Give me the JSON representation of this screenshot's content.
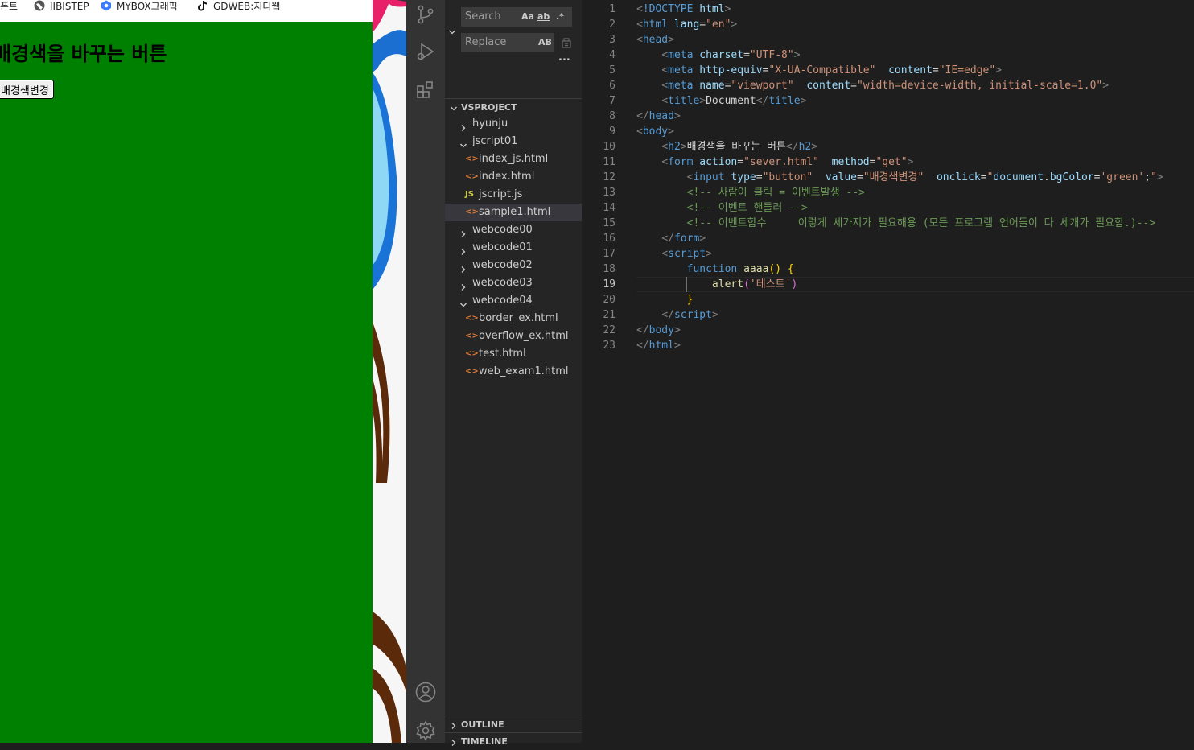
{
  "browser": {
    "bookmarks": [
      {
        "label": "폰트",
        "icon": "font-bookmark-icon"
      },
      {
        "label": "IIBISTEP",
        "icon": "globe-icon"
      },
      {
        "label": "MYBOX그래픽",
        "icon": "mybox-icon"
      },
      {
        "label": "GDWEB:지디웹",
        "icon": "tiktok-icon"
      }
    ],
    "page": {
      "heading": "배경색을 바꾸는 버튼",
      "button": "배경색변경",
      "background": "#008000"
    }
  },
  "find": {
    "search_placeholder": "Search",
    "replace_placeholder": "Replace",
    "opt_case": "Aa",
    "opt_word": "ab",
    "opt_regex": ".*",
    "opt_preserve_case": "AB",
    "more": "..."
  },
  "explorer": {
    "section": "VSPROJECT",
    "items": [
      {
        "label": "hyunju",
        "type": "folder",
        "open": false,
        "depth": 0
      },
      {
        "label": "jscript01",
        "type": "folder",
        "open": true,
        "depth": 0
      },
      {
        "label": "index_js.html",
        "type": "html",
        "depth": 1
      },
      {
        "label": "index.html",
        "type": "html",
        "depth": 1
      },
      {
        "label": "jscript.js",
        "type": "js",
        "depth": 1,
        "icon_text": "JS"
      },
      {
        "label": "sample1.html",
        "type": "html",
        "depth": 1,
        "selected": true
      },
      {
        "label": "webcode00",
        "type": "folder",
        "open": false,
        "depth": 0
      },
      {
        "label": "webcode01",
        "type": "folder",
        "open": false,
        "depth": 0
      },
      {
        "label": "webcode02",
        "type": "folder",
        "open": false,
        "depth": 0
      },
      {
        "label": "webcode03",
        "type": "folder",
        "open": false,
        "depth": 0
      },
      {
        "label": "webcode04",
        "type": "folder",
        "open": true,
        "depth": 0
      },
      {
        "label": "border_ex.html",
        "type": "html",
        "depth": 1
      },
      {
        "label": "overflow_ex.html",
        "type": "html",
        "depth": 1
      },
      {
        "label": "test.html",
        "type": "html",
        "depth": 1
      },
      {
        "label": "web_exam1.html",
        "type": "html",
        "depth": 1
      }
    ],
    "outline": "OUTLINE",
    "timeline": "TIMELINE"
  },
  "editor": {
    "active_line": 19,
    "lines": [
      [
        [
          "t-br",
          "<"
        ],
        [
          "t-tag",
          "!DOCTYPE "
        ],
        [
          "t-attr",
          "html"
        ],
        [
          "t-br",
          ">"
        ]
      ],
      [
        [
          "t-br",
          "<"
        ],
        [
          "t-tag",
          "html "
        ],
        [
          "t-attr",
          "lang"
        ],
        [
          "",
          "="
        ],
        [
          "t-str",
          "\"en\""
        ],
        [
          "t-br",
          ">"
        ]
      ],
      [
        [
          "t-br",
          "<"
        ],
        [
          "t-tag",
          "head"
        ],
        [
          "t-br",
          ">"
        ]
      ],
      [
        [
          "",
          "    "
        ],
        [
          "t-br",
          "<"
        ],
        [
          "t-tag",
          "meta "
        ],
        [
          "t-attr",
          "charset"
        ],
        [
          "",
          "="
        ],
        [
          "t-str",
          "\"UTF-8\""
        ],
        [
          "t-br",
          ">"
        ]
      ],
      [
        [
          "",
          "    "
        ],
        [
          "t-br",
          "<"
        ],
        [
          "t-tag",
          "meta "
        ],
        [
          "t-attr",
          "http-equiv"
        ],
        [
          "",
          "="
        ],
        [
          "t-str",
          "\"X-UA-Compatible\""
        ],
        [
          "",
          "  "
        ],
        [
          "t-attr",
          "content"
        ],
        [
          "",
          "="
        ],
        [
          "t-str",
          "\"IE=edge\""
        ],
        [
          "t-br",
          ">"
        ]
      ],
      [
        [
          "",
          "    "
        ],
        [
          "t-br",
          "<"
        ],
        [
          "t-tag",
          "meta "
        ],
        [
          "t-attr",
          "name"
        ],
        [
          "",
          "="
        ],
        [
          "t-str",
          "\"viewport\""
        ],
        [
          "",
          "  "
        ],
        [
          "t-attr",
          "content"
        ],
        [
          "",
          "="
        ],
        [
          "t-str",
          "\"width=device-width, initial-scale=1.0\""
        ],
        [
          "t-br",
          ">"
        ]
      ],
      [
        [
          "",
          "    "
        ],
        [
          "t-br",
          "<"
        ],
        [
          "t-tag",
          "title"
        ],
        [
          "t-br",
          ">"
        ],
        [
          "",
          "Document"
        ],
        [
          "t-br",
          "</"
        ],
        [
          "t-tag",
          "title"
        ],
        [
          "t-br",
          ">"
        ]
      ],
      [
        [
          "t-br",
          "</"
        ],
        [
          "t-tag",
          "head"
        ],
        [
          "t-br",
          ">"
        ]
      ],
      [
        [
          "t-br",
          "<"
        ],
        [
          "t-tag",
          "body"
        ],
        [
          "t-br",
          ">"
        ]
      ],
      [
        [
          "",
          "    "
        ],
        [
          "t-br",
          "<"
        ],
        [
          "t-tag",
          "h2"
        ],
        [
          "t-br",
          ">"
        ],
        [
          "",
          "배경색을 바꾸는 버튼"
        ],
        [
          "t-br",
          "</"
        ],
        [
          "t-tag",
          "h2"
        ],
        [
          "t-br",
          ">"
        ]
      ],
      [
        [
          "",
          "    "
        ],
        [
          "t-br",
          "<"
        ],
        [
          "t-tag",
          "form "
        ],
        [
          "t-attr",
          "action"
        ],
        [
          "",
          "="
        ],
        [
          "t-str",
          "\"sever.html\""
        ],
        [
          "",
          "  "
        ],
        [
          "t-attr",
          "method"
        ],
        [
          "",
          "="
        ],
        [
          "t-str",
          "\"get\""
        ],
        [
          "t-br",
          ">"
        ]
      ],
      [
        [
          "",
          "        "
        ],
        [
          "t-br",
          "<"
        ],
        [
          "t-tag",
          "input "
        ],
        [
          "t-attr",
          "type"
        ],
        [
          "",
          "="
        ],
        [
          "t-str",
          "\"button\""
        ],
        [
          "",
          "  "
        ],
        [
          "t-attr",
          "value"
        ],
        [
          "",
          "="
        ],
        [
          "t-str",
          "\"배경색변경\""
        ],
        [
          "",
          "  "
        ],
        [
          "t-attr",
          "onclick"
        ],
        [
          "",
          "="
        ],
        [
          "t-str",
          "\""
        ],
        [
          "t-attr",
          "document"
        ],
        [
          "",
          "."
        ],
        [
          "t-attr",
          "bgColor"
        ],
        [
          "",
          "="
        ],
        [
          "t-str",
          "'green'"
        ],
        [
          "",
          ";"
        ],
        [
          "t-str",
          "\""
        ],
        [
          "t-br",
          ">"
        ]
      ],
      [
        [
          "",
          "        "
        ],
        [
          "t-com",
          "<!-- 사람이 클릭 = 이벤트발생 -->"
        ]
      ],
      [
        [
          "",
          "        "
        ],
        [
          "t-com",
          "<!-- 이벤트 핸들러 -->"
        ]
      ],
      [
        [
          "",
          "        "
        ],
        [
          "t-com",
          "<!-- 이벤트함수     이렇게 세가지가 필요해용 (모든 프로그램 언어들이 다 세개가 필요함.)-->"
        ]
      ],
      [
        [
          "",
          "    "
        ],
        [
          "t-br",
          "</"
        ],
        [
          "t-tag",
          "form"
        ],
        [
          "t-br",
          ">"
        ]
      ],
      [
        [
          "",
          "    "
        ],
        [
          "t-br",
          "<"
        ],
        [
          "t-tag",
          "script"
        ],
        [
          "t-br",
          ">"
        ]
      ],
      [
        [
          "",
          "        "
        ],
        [
          "t-tag",
          "function "
        ],
        [
          "t-fn",
          "aaaa"
        ],
        [
          "t-paren",
          "() {"
        ]
      ],
      [
        [
          "",
          "            "
        ],
        [
          "t-fn",
          "alert"
        ],
        [
          "t-paren2",
          "("
        ],
        [
          "t-str",
          "'테스트'"
        ],
        [
          "t-paren2",
          ")"
        ]
      ],
      [
        [
          "",
          "        "
        ],
        [
          "t-paren",
          "}"
        ]
      ],
      [
        [
          "",
          "    "
        ],
        [
          "t-br",
          "</"
        ],
        [
          "t-tag",
          "script"
        ],
        [
          "t-br",
          ">"
        ]
      ],
      [
        [
          "t-br",
          "</"
        ],
        [
          "t-tag",
          "body"
        ],
        [
          "t-br",
          ">"
        ]
      ],
      [
        [
          "t-br",
          "</"
        ],
        [
          "t-tag",
          "html"
        ],
        [
          "t-br",
          ">"
        ]
      ]
    ]
  }
}
